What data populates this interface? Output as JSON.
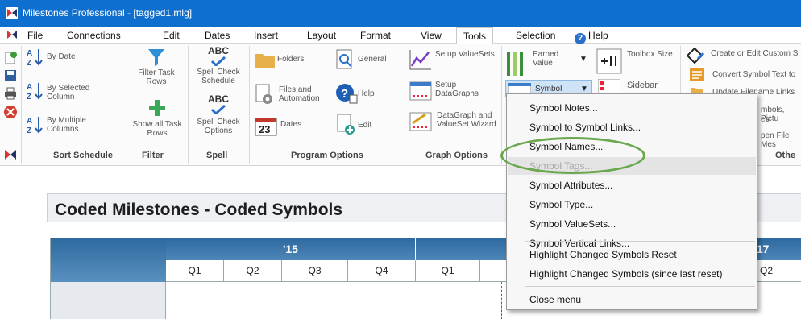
{
  "window": {
    "title": "Milestones Professional - [tagged1.mlg]"
  },
  "menubar": {
    "items": [
      "File",
      "Connections",
      "Edit",
      "Dates",
      "Insert",
      "Layout",
      "Format",
      "View",
      "Tools",
      "Selection",
      "Help"
    ],
    "active": "Tools"
  },
  "ribbon": {
    "sort_schedule": {
      "label": "Sort Schedule",
      "by_date": "By Date",
      "by_selected_column": "By Selected\nColumn",
      "by_multiple_columns": "By Multiple\nColumns"
    },
    "filter": {
      "label": "Filter",
      "filter_task_rows": "Filter Task\nRows",
      "show_all_task_rows": "Show all Task\nRows"
    },
    "spell": {
      "label": "Spell",
      "abc": "ABC",
      "spell_check_schedule": "Spell Check\nSchedule",
      "spell_check_options": "Spell Check\nOptions"
    },
    "program_options": {
      "label": "Program Options",
      "folders": "Folders",
      "general": "General",
      "files_and_automation": "Files and\nAutomation",
      "help": "Help",
      "dates": "Dates",
      "edit": "Edit",
      "calendar_number": "23"
    },
    "graph_options": {
      "label": "Graph Options",
      "setup_valuesets": "Setup ValueSets",
      "setup_datagraphs": "Setup\nDataGraphs",
      "datagraph_wizard": "DataGraph and\nValueSet Wizard"
    },
    "earned_value": "Earned\nValue",
    "symbol": "Symbol",
    "toolbox_size": "Toolbox Size",
    "sidebar": "Sidebar",
    "other": {
      "label": "Othe",
      "create_custom": "Create or Edit Custom S",
      "convert_symbol_text": "Convert Symbol Text to",
      "update_filename_links": "Update Filename Links",
      "partial_symbols_pictu": "mbols, Pictu",
      "partial_es": "es",
      "partial_open_file": "pen File Mes"
    }
  },
  "chart": {
    "title": "Coded Milestones - Coded Symbols",
    "years": [
      "'15",
      "'17"
    ],
    "quarters": [
      "Q1",
      "Q2",
      "Q3",
      "Q4",
      "Q1",
      "Q2"
    ]
  },
  "context_menu": {
    "items": [
      {
        "label": "Symbol Notes...",
        "disabled": false
      },
      {
        "label": "Symbol to Symbol Links...",
        "disabled": false
      },
      {
        "label": "Symbol Names...",
        "disabled": false
      },
      {
        "label": "Symbol Tags...",
        "disabled": true
      },
      {
        "label": "Symbol Attributes...",
        "disabled": false
      },
      {
        "label": "Symbol Type...",
        "disabled": false
      },
      {
        "label": "Symbol ValueSets...",
        "disabled": false
      },
      {
        "label": "Symbol Vertical Links...",
        "disabled": false
      },
      {
        "label": "Highlight Changed Symbols Reset",
        "disabled": false
      },
      {
        "label": "Highlight Changed Symbols (since last reset)",
        "disabled": false
      },
      {
        "label": "Close menu",
        "disabled": false
      }
    ]
  },
  "colors": {
    "titlebar": "#0f6fcf",
    "header_blue": "#2d6aa0",
    "highlight_ring": "#6aa84f"
  }
}
